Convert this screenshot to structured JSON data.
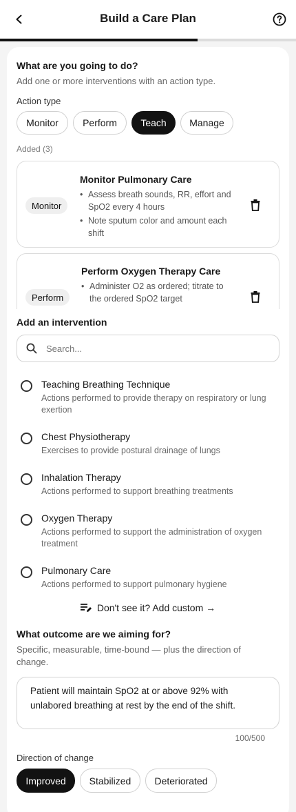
{
  "header": {
    "title": "Build a Care Plan",
    "back_icon": "chevron-left-icon",
    "help_icon": "help-circle-icon",
    "progress_fraction": 0.667
  },
  "actions_section": {
    "heading": "What are you going to do?",
    "subtitle": "Add one or more interventions with an action type.",
    "action_type_label": "Action type",
    "action_types": [
      {
        "label": "Monitor",
        "selected": false
      },
      {
        "label": "Perform",
        "selected": false
      },
      {
        "label": "Teach",
        "selected": true
      },
      {
        "label": "Manage",
        "selected": false
      }
    ],
    "added_label": "Added (3)",
    "added": [
      {
        "type": "Monitor",
        "title": "Monitor Pulmonary Care",
        "bullets": [
          "Assess breath sounds, RR, effort and SpO2 every 4 hours",
          "Note sputum color and amount each shift"
        ]
      },
      {
        "type": "Perform",
        "title": "Perform Oxygen Therapy Care",
        "bullets": [
          "Administer O2 as ordered; titrate to the ordered SpO2 target"
        ]
      }
    ]
  },
  "add_intervention": {
    "heading": "Add an intervention",
    "search_placeholder": "Search...",
    "options": [
      {
        "title": "Teaching Breathing Technique",
        "description": "Actions performed to provide therapy on respiratory or lung exertion"
      },
      {
        "title": "Chest Physiotherapy",
        "description": "Exercises to provide postural drainage of lungs"
      },
      {
        "title": "Inhalation Therapy",
        "description": "Actions performed to support breathing treatments"
      },
      {
        "title": "Oxygen Therapy",
        "description": "Actions performed to support the administration of oxygen treatment"
      },
      {
        "title": "Pulmonary Care",
        "description": "Actions performed to support pulmonary hygiene"
      }
    ],
    "custom_link": "Don't see it? Add custom →",
    "custom_icon": "playlist-edit-icon"
  },
  "outcome_section": {
    "heading": "What outcome are we aiming for?",
    "subtitle": "Specific, measurable, time-bound — plus the direction of change.",
    "text": "Patient will maintain SpO2 at or above 92% with unlabored breathing at rest by the end of the shift.",
    "counter": "100/500",
    "direction_label": "Direction of change",
    "directions": [
      {
        "label": "Improved",
        "selected": true
      },
      {
        "label": "Stabilized",
        "selected": false
      },
      {
        "label": "Deteriorated",
        "selected": false
      }
    ]
  },
  "colors": {
    "accent": "#121212",
    "background": "#f4f4f4",
    "muted_text": "#6a6a6a"
  }
}
